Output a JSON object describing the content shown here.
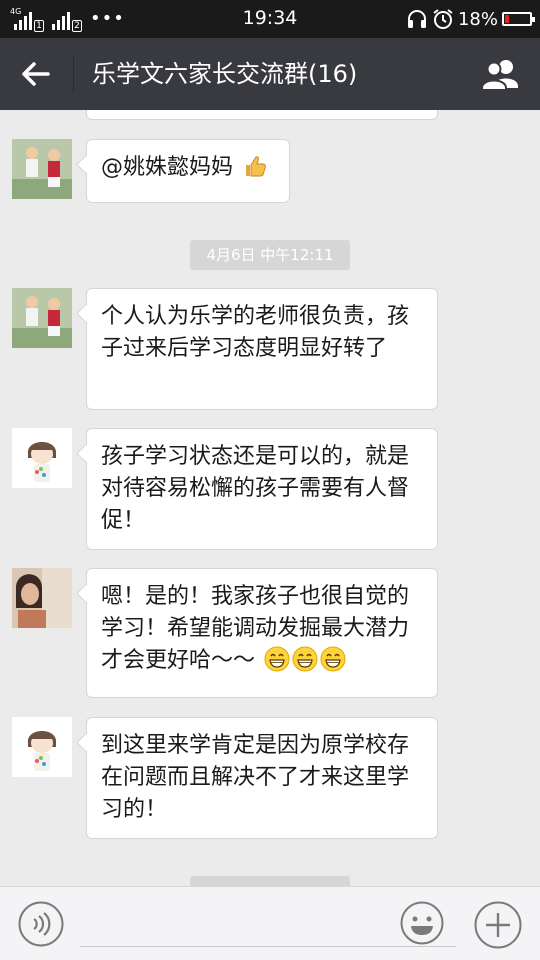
{
  "status_bar": {
    "time": "19:34",
    "network_label": "4G",
    "sim1": "1",
    "sim2": "2",
    "more": "•••",
    "battery_percent": "18%",
    "battery_level": 0.18,
    "battery_color": "#e62020"
  },
  "header": {
    "title": "乐学文六家长交流群(16)",
    "back_icon": "arrow-left-icon",
    "members_icon": "group-members-icon"
  },
  "messages": [
    {
      "text": "@姚姝懿妈妈",
      "emoji": [
        "thumbs-up-icon"
      ],
      "avatar": "avatar-children-photo"
    },
    {
      "timestamp": "4月6日 中午12:11"
    },
    {
      "text": "个人认为乐学的老师很负责，孩子过来后学习态度明显好转了",
      "avatar": "avatar-children-photo"
    },
    {
      "text": "孩子学习状态还是可以的，就是对待容易松懈的孩子需要有人督促！",
      "avatar": "avatar-cartoon-girl"
    },
    {
      "text": "嗯！是的！我家孩子也很自觉的学习！希望能调动发掘最大潜力才会更好哈～～",
      "emoji": [
        "grin-icon",
        "grin-icon",
        "grin-icon"
      ],
      "avatar": "avatar-woman-photo"
    },
    {
      "text": "到这里来学肯定是因为原学校存在问题而且解决不了才来这里学习的！",
      "avatar": "avatar-cartoon-girl"
    }
  ],
  "input_bar": {
    "voice_icon": "voice-icon",
    "emoji_icon": "smiley-icon",
    "more_icon": "plus-icon"
  },
  "colors": {
    "nav_bg": "#393a3f",
    "chat_bg": "#ebebeb",
    "timestamp_bg": "#d6d6d6"
  }
}
